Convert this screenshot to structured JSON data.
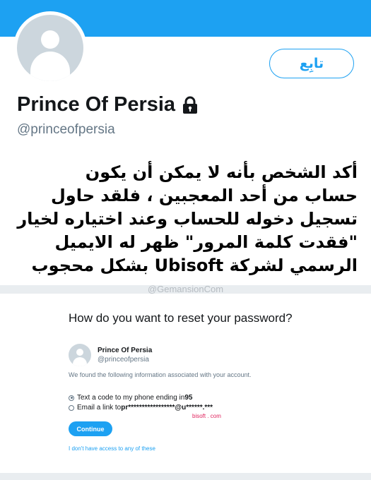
{
  "profile": {
    "display_name": "Prince Of Persia",
    "handle": "@princeofpersia",
    "follow_label": "تابِع",
    "protected_icon": "lock-icon"
  },
  "tweet": {
    "lines": [
      "أكد الشخص بأنه لا يمكن أن يكون",
      "حساب من أحد المعجبين ، فلقد حاول",
      "تسجيل دخوله للحساب وعند اختياره لخيار",
      "\"فقدت كلمة المرور\" ظهر له الايميل",
      "الرسمي لشركة Ubisoft بشكل محجوب"
    ]
  },
  "watermark": "@GemansionCom",
  "reset": {
    "title": "How do you want to reset your password?",
    "account_name": "Prince Of Persia",
    "account_handle": "@princeofpersia",
    "found_text": "We found the following information associated with your account.",
    "option_phone_prefix": "Text a code to my phone ending in ",
    "option_phone_digits": "95",
    "option_email_prefix": "Email a link to ",
    "option_email_masked": "pr*****************@u******.***",
    "domain_note": "bisoft . com",
    "continue_label": "Continue",
    "no_access_label": "I don't have access to any of these"
  },
  "colors": {
    "accent": "#1da1f2",
    "annotation_red": "#e0245e"
  }
}
